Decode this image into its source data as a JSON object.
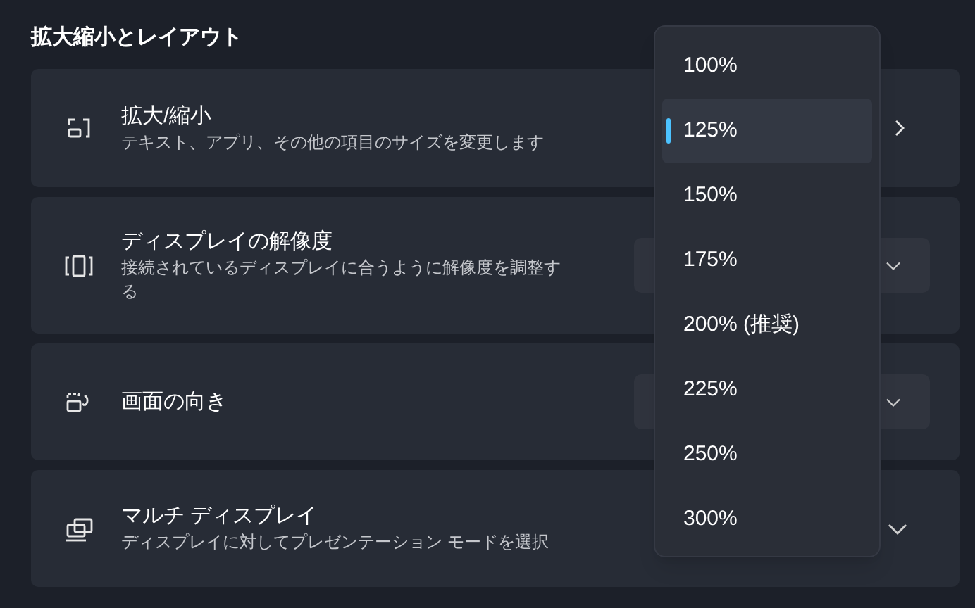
{
  "section_title": "拡大縮小とレイアウト",
  "settings": [
    {
      "kind": "link",
      "title": "拡大/縮小",
      "description": "テキスト、アプリ、その他の項目のサイズを変更します"
    },
    {
      "kind": "combo",
      "title": "ディスプレイの解像度",
      "description": "接続されているディスプレイに合うように解像度を調整する"
    },
    {
      "kind": "combo",
      "title": "画面の向き"
    },
    {
      "kind": "expand",
      "title": "マルチ ディスプレイ",
      "description": "ディスプレイに対してプレゼンテーション モードを選択"
    }
  ],
  "scale_menu": {
    "options": [
      {
        "label": "100%",
        "selected": false
      },
      {
        "label": "125%",
        "selected": true
      },
      {
        "label": "150%",
        "selected": false
      },
      {
        "label": "175%",
        "selected": false
      },
      {
        "label": "200% (推奨)",
        "selected": false
      },
      {
        "label": "225%",
        "selected": false
      },
      {
        "label": "250%",
        "selected": false
      },
      {
        "label": "300%",
        "selected": false
      }
    ]
  }
}
